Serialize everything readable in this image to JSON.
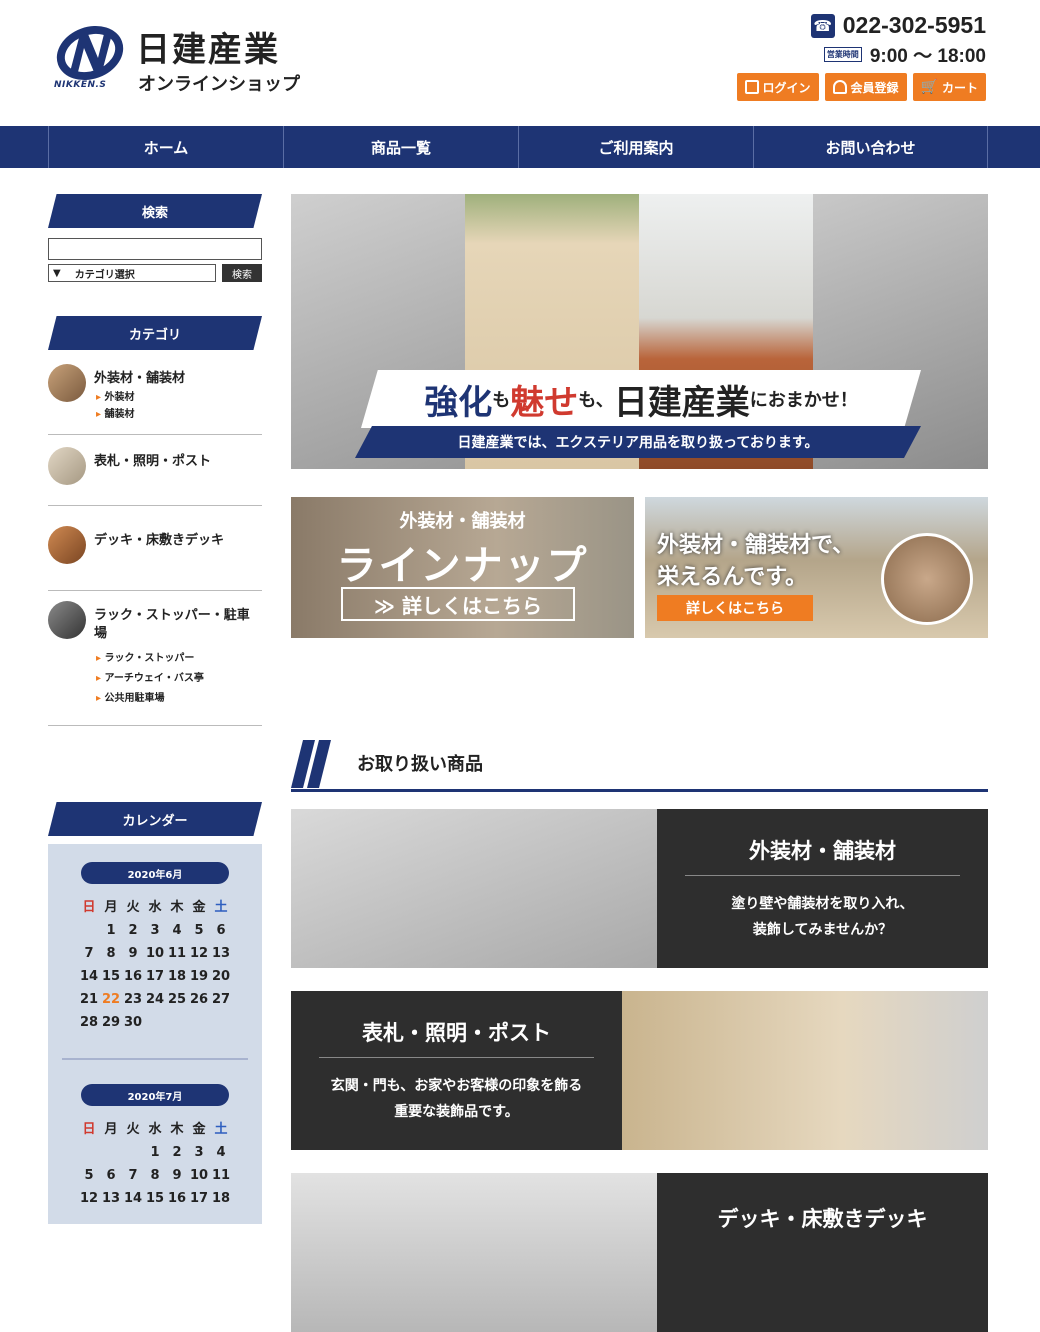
{
  "header": {
    "logo_sub": "NIKKEN.S",
    "logo_title": "日建産業",
    "logo_tag": "オンラインショップ",
    "phone": "022-302-5951",
    "hours_badge": "営業時間",
    "hours": "9:00 〜 18:00",
    "buttons": {
      "login": "ログイン",
      "register": "会員登録",
      "cart": "カート"
    }
  },
  "nav": {
    "home": "ホーム",
    "products": "商品一覧",
    "guide": "ご利用案内",
    "contact": "お問い合わせ"
  },
  "sidebar": {
    "search_heading": "検索",
    "search_select": "カテゴリ選択",
    "search_select_arrow": "▼",
    "search_button": "検索",
    "category_heading": "カテゴリ",
    "categories": [
      {
        "label": "外装材・舗装材",
        "subs": [
          "外装材",
          "舗装材"
        ]
      },
      {
        "label": "表札・照明・ポスト"
      },
      {
        "label": "デッキ・床敷きデッキ"
      },
      {
        "label": "ラック・ストッパー・駐車場",
        "subs": [
          "ラック・ストッパー",
          "アーチウェイ・バス亭",
          "公共用駐車場"
        ]
      }
    ],
    "calendar_heading": "カレンダー",
    "calendar": {
      "weekdays": [
        "日",
        "月",
        "火",
        "水",
        "木",
        "金",
        "土"
      ],
      "june_label": "2020年6月",
      "june_days": [
        "",
        "1",
        "2",
        "3",
        "4",
        "5",
        "6",
        "7",
        "8",
        "9",
        "10",
        "11",
        "12",
        "13",
        "14",
        "15",
        "16",
        "17",
        "18",
        "19",
        "20",
        "21",
        "22",
        "23",
        "24",
        "25",
        "26",
        "27",
        "28",
        "29",
        "30"
      ],
      "june_highlight": "22",
      "july_label": "2020年7月",
      "july_days": [
        "",
        "",
        "",
        "1",
        "2",
        "3",
        "4",
        "5",
        "6",
        "7",
        "8",
        "9",
        "10",
        "11",
        "12",
        "13",
        "14",
        "15",
        "16",
        "17",
        "18"
      ]
    }
  },
  "hero": {
    "h1": "強化",
    "h2": "も",
    "h3": "魅せ",
    "h4": "も、",
    "h5": "日建産業",
    "h6": "におまかせ！",
    "subline": "日建産業では、エクステリア用品を取り扱っております。"
  },
  "promo_left": {
    "sub": "外装材・舗装材",
    "title": "ラインナップ",
    "button": "≫ 詳しくはこちら"
  },
  "promo_right": {
    "line1": "外装材・舗装材で、",
    "line2": "栄えるんです。",
    "button": "詳しくはこちら"
  },
  "section": {
    "title": "お取り扱い商品"
  },
  "products": [
    {
      "title": "外装材・舗装材",
      "desc": "塗り壁や舗装材を取り入れ、\n装飾してみませんか？"
    },
    {
      "title": "表札・照明・ポスト",
      "desc": "玄関・門も、お家やお客様の印象を飾る\n重要な装飾品です。"
    },
    {
      "title": "デッキ・床敷きデッキ",
      "desc": ""
    }
  ],
  "colors": {
    "navy": "#1e3474",
    "orange": "#ef7c22",
    "red": "#d03a2f",
    "dark_panel": "#2e2e2e",
    "calendar_bg": "#d2dbe8"
  }
}
